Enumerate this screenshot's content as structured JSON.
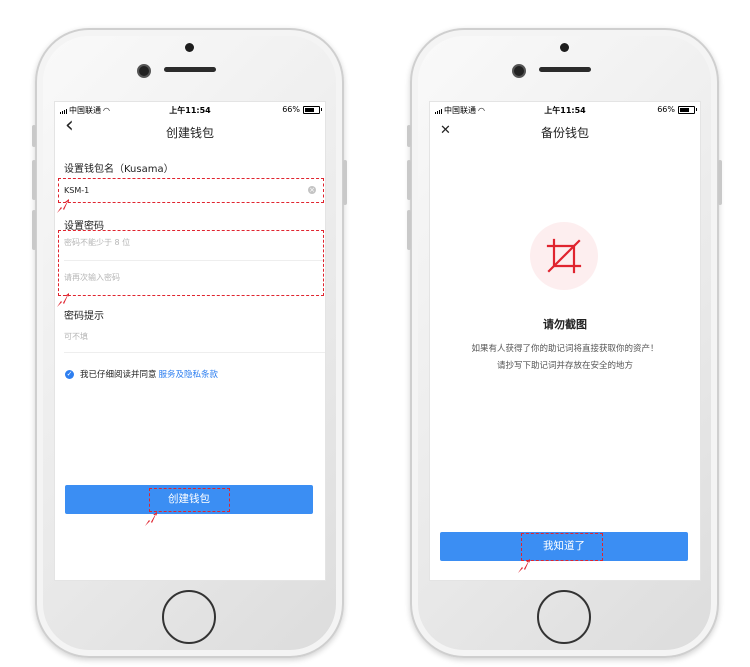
{
  "screen1": {
    "status": {
      "carrier": "中国联通",
      "time": "上午11:54",
      "battery": "66%"
    },
    "title": "创建钱包",
    "back_icon": "‹",
    "wallet_name_label": "设置钱包名（Kusama）",
    "wallet_name_value": "KSM-1",
    "password_label": "设置密码",
    "password_placeholder": "密码不能少于 8 位",
    "password_confirm_placeholder": "请再次输入密码",
    "hint_label": "密码提示",
    "hint_placeholder": "可不填",
    "agree_text": "我已仔细阅读并同意",
    "agree_link": "服务及隐私条款",
    "create_button": "创建钱包"
  },
  "screen2": {
    "status": {
      "carrier": "中国联通",
      "time": "上午11:54",
      "battery": "66%"
    },
    "title": "备份钱包",
    "close_icon": "✕",
    "warning_title": "请勿截图",
    "warning_line1": "如果有人获得了你的助记词将直接获取你的资产！",
    "warning_line2": "请抄写下助记词并存放在安全的地方",
    "confirm_button": "我知道了"
  },
  "colors": {
    "accent": "#3b8ef3",
    "highlight": "#e0242f",
    "warning_bg": "#fdeeef"
  },
  "icons": [
    "signal-icon",
    "wifi-icon",
    "battery-icon",
    "back-icon",
    "clear-icon",
    "check-icon",
    "close-icon",
    "no-screenshot-icon",
    "pointer-icon"
  ]
}
